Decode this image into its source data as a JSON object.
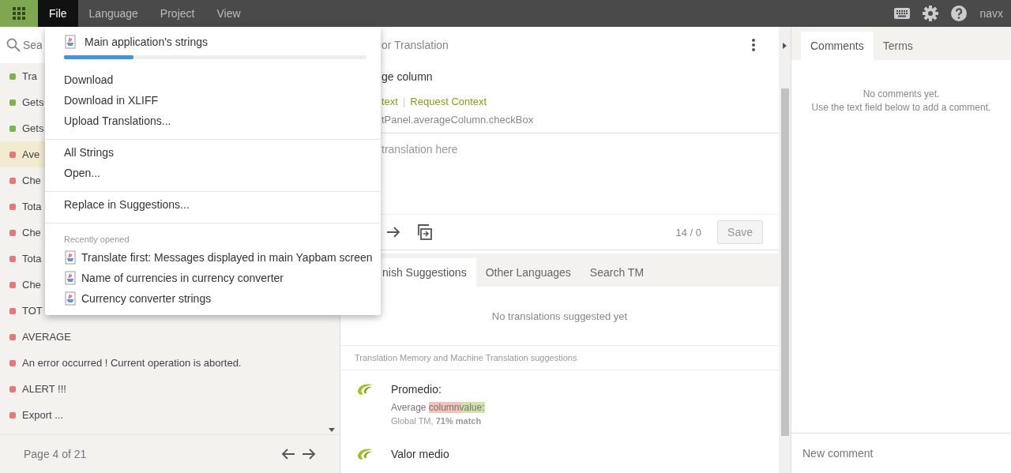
{
  "top_bar": {
    "menus": [
      {
        "label": "File",
        "selected": true
      },
      {
        "label": "Language",
        "selected": false
      },
      {
        "label": "Project",
        "selected": false
      },
      {
        "label": "View",
        "selected": false
      }
    ],
    "user": "navx"
  },
  "sidebar": {
    "search": {
      "placeholder": "Sea"
    },
    "items": [
      {
        "text": "Tra",
        "color": "#7ab648",
        "selected": false
      },
      {
        "text": "Gets",
        "color": "#7ab648",
        "selected": false
      },
      {
        "text": "Gets",
        "color": "#7ab648",
        "selected": false
      },
      {
        "text": "Ave",
        "color": "#e8777b",
        "selected": true
      },
      {
        "text": "Che",
        "color": "#e8777b",
        "selected": false
      },
      {
        "text": "Tota",
        "color": "#e8777b",
        "selected": false
      },
      {
        "text": "Che",
        "color": "#e8777b",
        "selected": false
      },
      {
        "text": "Tota",
        "color": "#e8777b",
        "selected": false
      },
      {
        "text": "Che",
        "color": "#e8777b",
        "selected": false
      },
      {
        "text": "TOT",
        "color": "#e8777b",
        "selected": false
      },
      {
        "text": "AVERAGE",
        "color": "#e8777b",
        "selected": false
      },
      {
        "text": "An error occurred ! Current operation is aborted.",
        "color": "#e8777b",
        "selected": false
      },
      {
        "text": "ALERT !!!",
        "color": "#e8777b",
        "selected": false
      },
      {
        "text": "Export ...",
        "color": "#e8777b",
        "selected": false
      }
    ],
    "pager": "Page 4 of 21"
  },
  "file_menu": {
    "current": {
      "name": "Main application's strings",
      "level": 0.23
    },
    "groups": [
      [
        "Download",
        "Download in XLIFF",
        "Upload Translations..."
      ],
      [
        "All Strings",
        "Open..."
      ],
      [
        "Replace in Suggestions..."
      ]
    ],
    "recent": {
      "label": "Recently opened",
      "items": [
        "Translate first: Messages displayed in main Yapbam screen",
        "Name of currencies in currency converter",
        "Currency converter strings"
      ]
    }
  },
  "editor": {
    "title": "or Translation",
    "source": "ge column",
    "links": [
      "text",
      "Request Context"
    ],
    "link_separator": "|",
    "key": "tPanel.averageColumn.checkBox",
    "translation": {
      "placeholder": "translation here"
    },
    "counter": "14 / 0",
    "save": {
      "label": "Save",
      "disabled": true
    },
    "tabs": [
      {
        "label": "nish Suggestions",
        "selected": true
      },
      {
        "label": "Other Languages",
        "selected": false
      },
      {
        "label": "Search TM",
        "selected": false
      }
    ],
    "empty_message": "No translations suggested yet",
    "tm_heading": "Translation Memory and Machine Translation suggestions",
    "suggestions": [
      {
        "text": "Promedio:",
        "source": "Average **columnvalue:**",
        "meta": "Global TM, **71% match**"
      },
      {
        "text": "Valor medio"
      }
    ]
  },
  "right_panel": {
    "tabs": [
      {
        "label": "Comments",
        "selected": true
      },
      {
        "label": "Terms",
        "selected": false
      }
    ],
    "empty_lines": [
      "No comments yet.",
      "Use the text field below to add a comment."
    ],
    "comment": {
      "placeholder": "New comment"
    }
  }
}
